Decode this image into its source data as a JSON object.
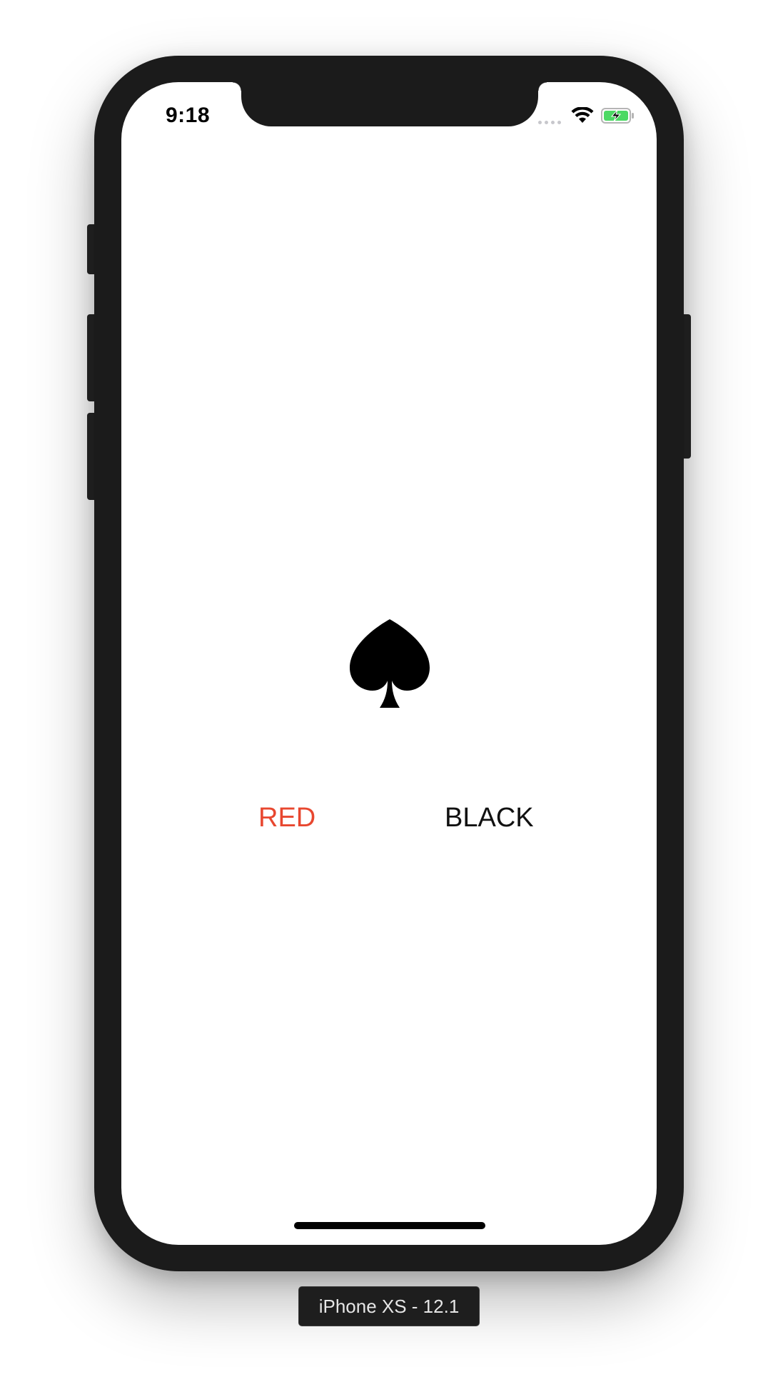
{
  "status_bar": {
    "time": "9:18",
    "signal_icon": "signal-dots-icon",
    "wifi_icon": "wifi-icon",
    "battery_icon": "battery-charging-icon",
    "battery_color": "#4cd964"
  },
  "game": {
    "suit_icon": "spade-icon",
    "red_label": "RED",
    "black_label": "BLACK",
    "red_color": "#e8472f",
    "black_color": "#111111"
  },
  "device": {
    "label": "iPhone XS - 12.1"
  }
}
